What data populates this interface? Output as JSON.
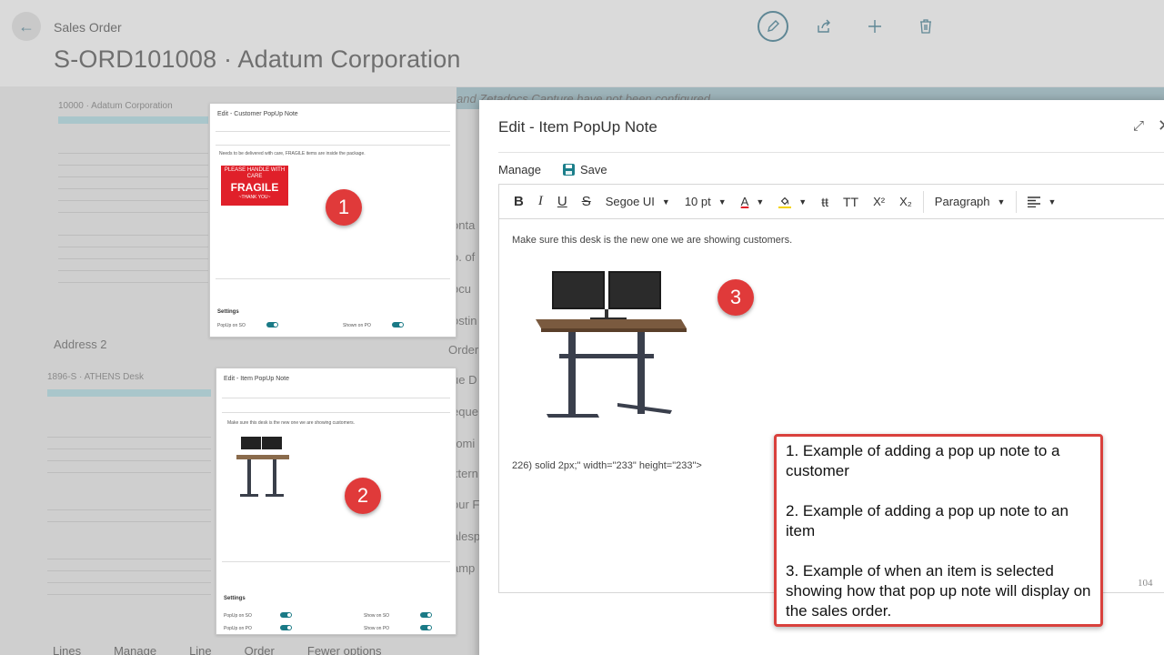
{
  "page": {
    "caption": "Sales Order",
    "title": "S-ORD101008 · Adatum Corporation",
    "banner": "and Zetadocs Capture have not been configured",
    "side_labels": [
      "onta",
      "o. of",
      "ocu",
      "ostin",
      "Order",
      "ue D",
      "eque",
      "romi",
      "xtern",
      "our F",
      "alesp",
      "amp"
    ],
    "address_label": "Address 2",
    "customer_card": "10000 · Adatum Corporation",
    "item_card": "1896-S · ATHENS Desk",
    "bottom_tabs": [
      "Lines",
      "Manage",
      "Line",
      "Order",
      "Fewer options"
    ]
  },
  "top_actions": {
    "edit": "pencil-icon",
    "share": "share-icon",
    "new": "plus-icon",
    "delete": "trash-icon"
  },
  "thumb1": {
    "title": "Edit - Customer PopUp Note",
    "text": "Needs to be delivered with care, FRAGILE items are inside the package.",
    "fragile_top": "PLEASE HANDLE WITH CARE",
    "fragile_main": "FRAGILE",
    "fragile_bottom": "~THANK YOU~",
    "settings": "Settings",
    "toggle1": "PopUp on SO",
    "toggle2": "Shown on PO"
  },
  "thumb2": {
    "title": "Edit - Item PopUp Note",
    "text": "Make sure this desk is the new one we are showing customers.",
    "settings": "Settings",
    "toggle1": "PopUp on SO",
    "toggle2": "PopUp on PO",
    "toggle3": "Show on SO",
    "toggle4": "Show on PO"
  },
  "badges": {
    "one": "1",
    "two": "2",
    "three": "3"
  },
  "dialog": {
    "title": "Edit - Item PopUp Note",
    "manage": "Manage",
    "save": "Save",
    "toolbar": {
      "bold": "B",
      "italic": "I",
      "underline": "U",
      "strike": "S",
      "font": "Segoe UI",
      "size": "10 pt",
      "font_color": "A",
      "superscript": "X²",
      "subscript": "X₂",
      "paragraph": "Paragraph"
    },
    "body_line1": "Make sure this desk is the new one we are showing customers.",
    "body_line2": "226) solid 2px;\" width=\"233\" height=\"233\">",
    "word_count": "104"
  },
  "callout": {
    "item1": "1. Example of adding a pop up note to a customer",
    "item2": "2. Example of adding a pop up note to an item",
    "item3": "3. Example of when an item is selected showing how that pop up note will display on the sales order."
  },
  "colors": {
    "accent": "#1c7f8b",
    "callout_border": "#d9413d",
    "badge": "#e03a3a",
    "fragile": "#e0202a"
  }
}
